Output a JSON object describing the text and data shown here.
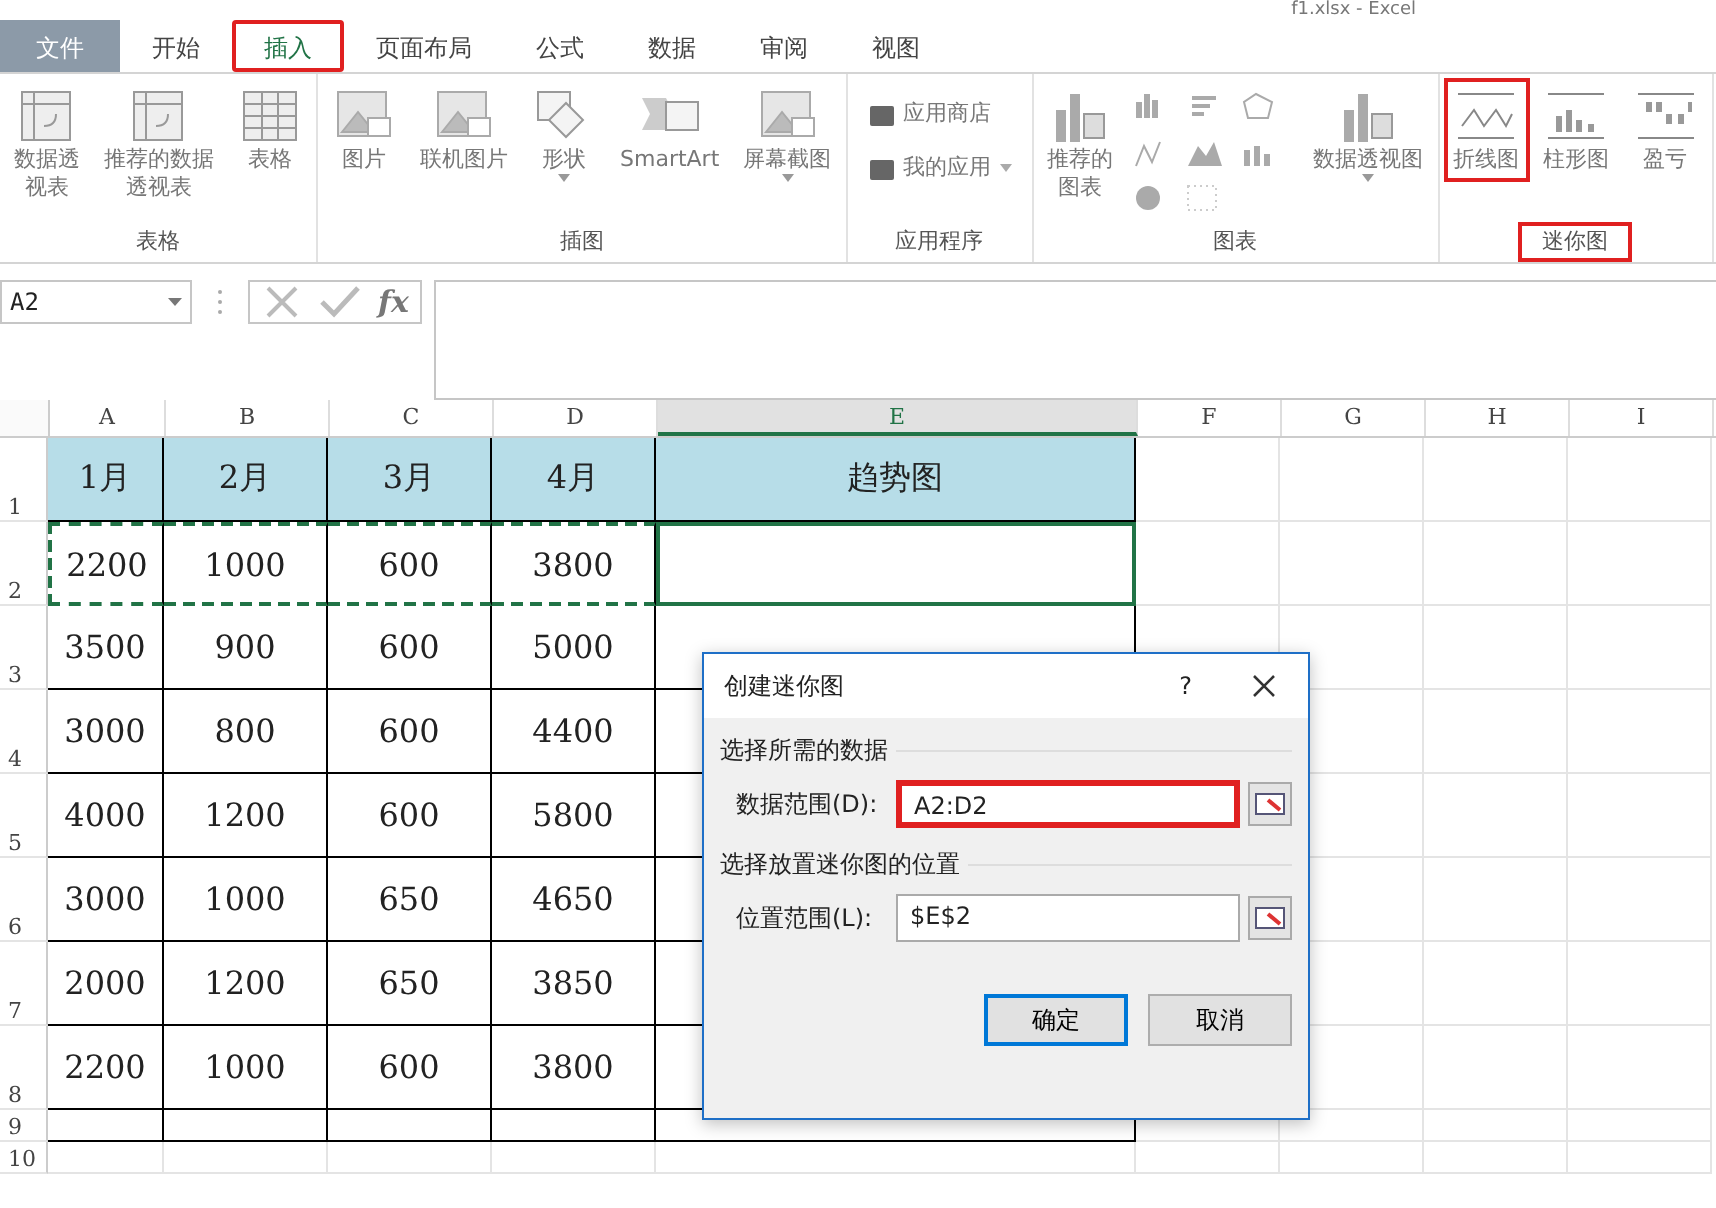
{
  "window": {
    "title": "f1.xlsx - Excel"
  },
  "tabs": [
    {
      "label": "文件",
      "kind": "file",
      "selected": false,
      "highlighted": false
    },
    {
      "label": "开始",
      "kind": "tab",
      "selected": false,
      "highlighted": false
    },
    {
      "label": "插入",
      "kind": "tab",
      "selected": true,
      "highlighted": true
    },
    {
      "label": "页面布局",
      "kind": "tab",
      "selected": false,
      "highlighted": false
    },
    {
      "label": "公式",
      "kind": "tab",
      "selected": false,
      "highlighted": false
    },
    {
      "label": "数据",
      "kind": "tab",
      "selected": false,
      "highlighted": false
    },
    {
      "label": "审阅",
      "kind": "tab",
      "selected": false,
      "highlighted": false
    },
    {
      "label": "视图",
      "kind": "tab",
      "selected": false,
      "highlighted": false
    }
  ],
  "ribbon": [
    {
      "label": "表格",
      "highlighted": false,
      "items": [
        {
          "kind": "large",
          "label": "数据透视表",
          "highlighted": false
        },
        {
          "kind": "large",
          "label": "推荐的数据透视表",
          "highlighted": false
        },
        {
          "kind": "large",
          "label": "表格",
          "highlighted": false
        }
      ]
    },
    {
      "label": "插图",
      "highlighted": false,
      "items": [
        {
          "kind": "large",
          "label": "图片",
          "highlighted": false
        },
        {
          "kind": "large",
          "label": "联机图片",
          "highlighted": false
        },
        {
          "kind": "large",
          "label": "形状",
          "dropdown": true,
          "highlighted": false
        },
        {
          "kind": "large",
          "label": "SmartArt",
          "highlighted": false
        },
        {
          "kind": "large",
          "label": "屏幕截图",
          "dropdown": true,
          "highlighted": false
        }
      ]
    },
    {
      "label": "应用程序",
      "highlighted": false,
      "items": [
        {
          "kind": "small",
          "label": "应用商店",
          "highlighted": false
        },
        {
          "kind": "small",
          "label": "我的应用",
          "dropdown": true,
          "highlighted": false
        }
      ]
    },
    {
      "label": "图表",
      "highlighted": false,
      "items": [
        {
          "kind": "large",
          "label": "推荐的图表",
          "highlighted": false
        },
        {
          "kind": "grid",
          "highlighted": false
        },
        {
          "kind": "large",
          "label": "数据透视图",
          "dropdown": true,
          "highlighted": false
        }
      ]
    },
    {
      "label": "迷你图",
      "highlighted": true,
      "items": [
        {
          "kind": "large",
          "label": "折线图",
          "highlighted": true
        },
        {
          "kind": "large",
          "label": "柱形图",
          "highlighted": false
        },
        {
          "kind": "large",
          "label": "盈亏",
          "highlighted": false
        }
      ]
    }
  ],
  "name_box": {
    "value": "A2"
  },
  "formula_bar": {
    "fx": "fx"
  },
  "columns": [
    "A",
    "B",
    "C",
    "D",
    "E",
    "F",
    "G",
    "H",
    "I"
  ],
  "rows": [
    {
      "number": "1",
      "kind": "header",
      "cells": [
        "1月",
        "2月",
        "3月",
        "4月",
        "趋势图"
      ]
    },
    {
      "number": "2",
      "kind": "data",
      "cells": [
        "2200",
        "1000",
        "600",
        "3800",
        ""
      ]
    },
    {
      "number": "3",
      "kind": "data",
      "cells": [
        "3500",
        "900",
        "600",
        "5000",
        ""
      ]
    },
    {
      "number": "4",
      "kind": "data",
      "cells": [
        "3000",
        "800",
        "600",
        "4400",
        ""
      ]
    },
    {
      "number": "5",
      "kind": "data",
      "cells": [
        "4000",
        "1200",
        "600",
        "5800",
        ""
      ]
    },
    {
      "number": "6",
      "kind": "data",
      "cells": [
        "3000",
        "1000",
        "650",
        "4650",
        ""
      ]
    },
    {
      "number": "7",
      "kind": "data",
      "cells": [
        "2000",
        "1200",
        "650",
        "3850",
        ""
      ]
    },
    {
      "number": "8",
      "kind": "data",
      "cells": [
        "2200",
        "1000",
        "600",
        "3800",
        ""
      ]
    },
    {
      "number": "9",
      "kind": "empty",
      "cells": [
        "",
        "",
        "",
        "",
        ""
      ]
    },
    {
      "number": "10",
      "kind": "blank",
      "cells": []
    }
  ],
  "dialog": {
    "title": "创建迷你图",
    "help": "?",
    "section1": "选择所需的数据",
    "field1": {
      "label": "数据范围(D):",
      "value": "A2:D2",
      "highlighted": true
    },
    "section2": "选择放置迷你图的位置",
    "field2": {
      "label": "位置范围(L):",
      "value": "$E$2",
      "highlighted": false
    },
    "buttons": [
      {
        "label": "确定",
        "default": true
      },
      {
        "label": "取消",
        "default": false
      }
    ]
  }
}
